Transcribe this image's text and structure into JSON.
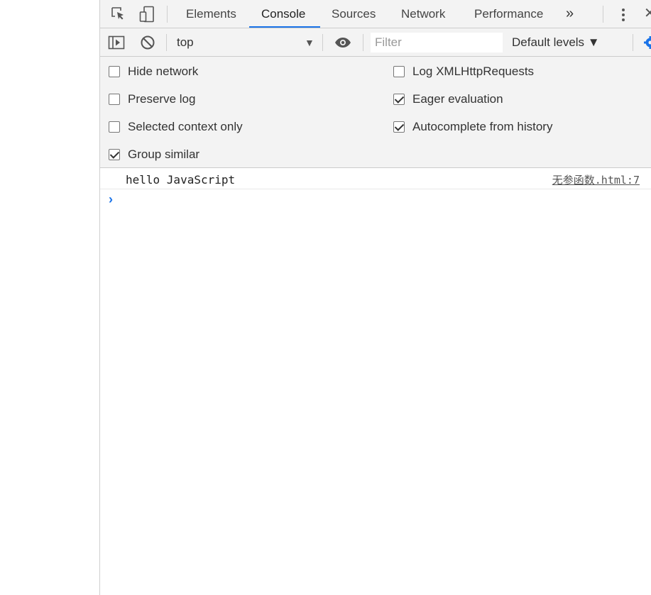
{
  "devtools": {
    "tabs": [
      {
        "label": "Elements",
        "active": false
      },
      {
        "label": "Console",
        "active": true
      },
      {
        "label": "Sources",
        "active": false
      },
      {
        "label": "Network",
        "active": false
      },
      {
        "label": "Performance",
        "active": false
      }
    ],
    "more_tabs_glyph": "»",
    "close_glyph": "✕",
    "icons": [
      "inspect-element-icon",
      "device-toolbar-icon",
      "more-tabs-icon",
      "kebab-menu-icon",
      "close-icon"
    ]
  },
  "console_toolbar": {
    "context": "top",
    "context_arrow": "▼",
    "filter_placeholder": "Filter",
    "levels_label": "Default levels ▼",
    "icons": [
      "sidebar-toggle-icon",
      "clear-console-icon",
      "eye-icon",
      "gear-icon"
    ]
  },
  "settings": {
    "left": [
      {
        "label": "Hide network",
        "checked": false
      },
      {
        "label": "Preserve log",
        "checked": false
      },
      {
        "label": "Selected context only",
        "checked": false
      },
      {
        "label": "Group similar",
        "checked": true
      }
    ],
    "right": [
      {
        "label": "Log XMLHttpRequests",
        "checked": false
      },
      {
        "label": "Eager evaluation",
        "checked": true
      },
      {
        "label": "Autocomplete from history",
        "checked": true
      }
    ]
  },
  "console": {
    "messages": [
      {
        "text": "hello JavaScript",
        "source": "无参函数.html:7"
      }
    ],
    "prompt_glyph": "›"
  },
  "colors": {
    "accent": "#1a73e8",
    "toolbar_bg": "#f3f3f3",
    "border": "#cbcbcb"
  }
}
